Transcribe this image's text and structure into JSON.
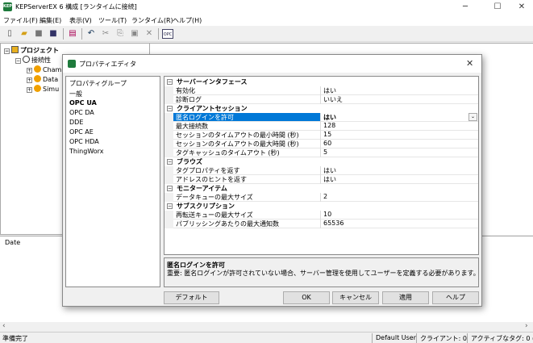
{
  "app": {
    "icon_text": "KEP",
    "title": "KEPServerEX 6 構成 [ランタイムに接続]"
  },
  "menu": [
    "ファイル(F)",
    "編集(E)",
    "表示(V)",
    "ツール(T)",
    "ランタイム(R)",
    "ヘルプ(H)"
  ],
  "toolbar": {
    "opc_label": "OPC"
  },
  "tree": {
    "root": "プロジェクト",
    "connectivity": "接続性",
    "children": [
      "Cham",
      "Data",
      "Simu"
    ]
  },
  "log": {
    "date_header": "Date"
  },
  "status": {
    "ready": "準備完了",
    "user": "Default User",
    "clients": "クライアント: 0",
    "active_tags": "アクティブなタグ: 0 ("
  },
  "dialog": {
    "title": "プロパティエディタ",
    "groups": [
      "プロパティグループ",
      "一般",
      "OPC UA",
      "OPC DA",
      "DDE",
      "OPC AE",
      "OPC HDA",
      "ThingWorx"
    ],
    "selected_group": "OPC UA",
    "categories": [
      {
        "name": "サーバーインタフェース",
        "props": [
          {
            "name": "有効化",
            "value": "はい"
          },
          {
            "name": "診断ログ",
            "value": "いいえ"
          }
        ]
      },
      {
        "name": "クライアントセッション",
        "props": [
          {
            "name": "匿名ログインを許可",
            "value": "はい",
            "selected": true
          },
          {
            "name": "最大接続数",
            "value": "128"
          },
          {
            "name": "セッションのタイムアウトの最小時間 (秒)",
            "value": "15"
          },
          {
            "name": "セッションのタイムアウトの最大時間 (秒)",
            "value": "60"
          },
          {
            "name": "タグキャッシュのタイムアウト (秒)",
            "value": "5"
          }
        ]
      },
      {
        "name": "ブラウズ",
        "props": [
          {
            "name": "タグプロパティを返す",
            "value": "はい"
          },
          {
            "name": "アドレスのヒントを返す",
            "value": "はい"
          }
        ]
      },
      {
        "name": "モニターアイテム",
        "props": [
          {
            "name": "データキューの最大サイズ",
            "value": "2"
          }
        ]
      },
      {
        "name": "サブスクリプション",
        "props": [
          {
            "name": "再転送キューの最大サイズ",
            "value": "10"
          },
          {
            "name": "パブリッシングあたりの最大通知数",
            "value": "65536"
          }
        ]
      }
    ],
    "description": {
      "title": "匿名ログインを許可",
      "body": "重要: 匿名ログインが許可されていない場合、サーバー管理を使用してユーザーを定義する必要があります。"
    },
    "buttons": {
      "default": "デフォルト",
      "ok": "OK",
      "cancel": "キャンセル",
      "apply": "適用",
      "help": "ヘルプ"
    }
  }
}
